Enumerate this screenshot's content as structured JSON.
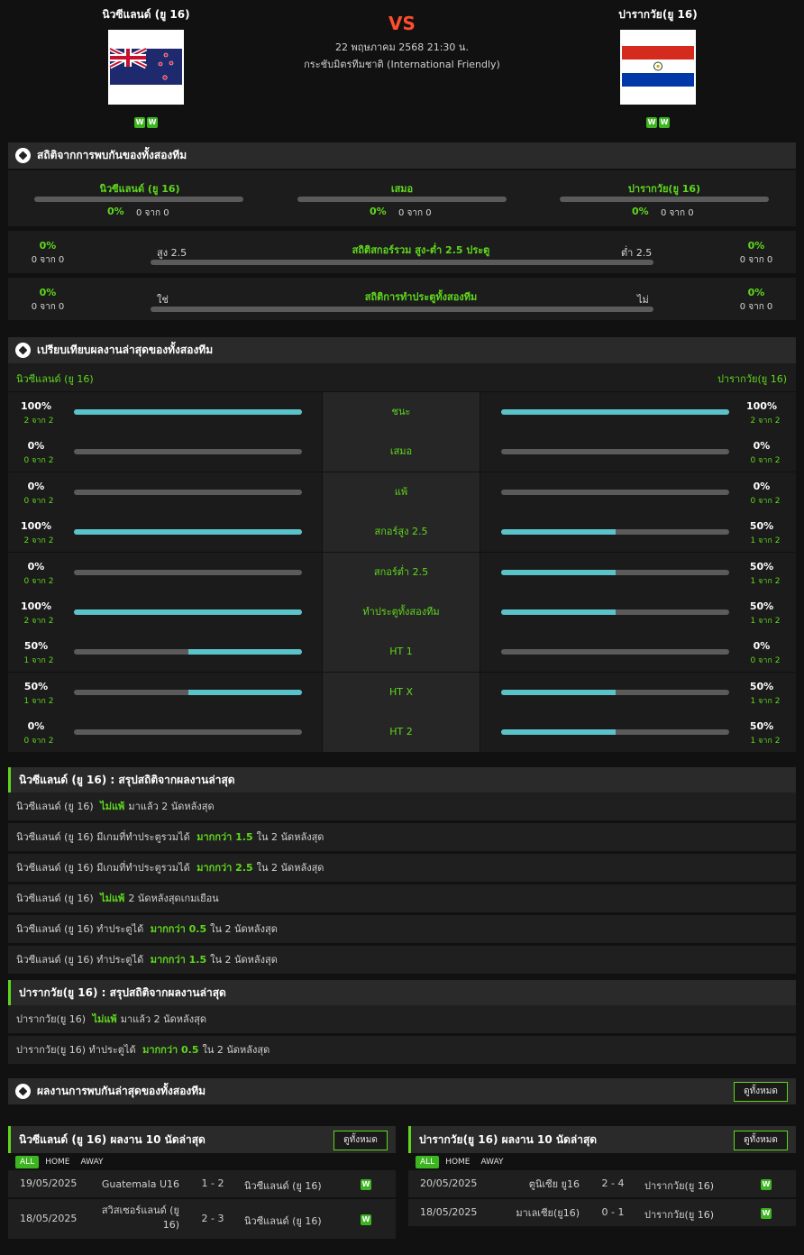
{
  "header": {
    "home_name": "นิวซีแลนด์ (ยู 16)",
    "away_name": "ปารากวัย(ยู 16)",
    "vs": "VS",
    "date": "22 พฤษภาคม 2568 21:30 น.",
    "competition": "กระชับมิตรทีมชาติ (International Friendly)",
    "home_form": [
      "W",
      "W"
    ],
    "away_form": [
      "W",
      "W"
    ]
  },
  "h2h": {
    "title": "สถิติจากการพบกันของทั้งสองทีม",
    "home": {
      "label": "นิวซีแลนด์ (ยู 16)",
      "pct": "0%",
      "of": "0 จาก 0"
    },
    "draw": {
      "label": "เสมอ",
      "pct": "0%",
      "of": "0 จาก 0"
    },
    "away": {
      "label": "ปารากวัย(ยู 16)",
      "pct": "0%",
      "of": "0 จาก 0"
    },
    "ou": {
      "title": "สถิติสกอร์รวม สูง-ต่ำ 2.5 ประตู",
      "left_label": "สูง 2.5",
      "right_label": "ต่ำ 2.5",
      "left_pct": "0%",
      "left_of": "0 จาก 0",
      "right_pct": "0%",
      "right_of": "0 จาก 0"
    },
    "btts": {
      "title": "สถิติการทำประตูทั้งสองทีม",
      "left_label": "ใช่",
      "right_label": "ไม่",
      "left_pct": "0%",
      "left_of": "0 จาก 0",
      "right_pct": "0%",
      "right_of": "0 จาก 0"
    }
  },
  "compare": {
    "title": "เปรียบเทียบผลงานล่าสุดของทั้งสองทีม",
    "home_label": "นิวซีแลนด์ (ยู 16)",
    "away_label": "ปารากวัย(ยู 16)",
    "rows": [
      {
        "label": "ชนะ",
        "home_pct": "100%",
        "home_of": "2 จาก 2",
        "home_val": 1.0,
        "away_pct": "100%",
        "away_of": "2 จาก 2",
        "away_val": 1.0
      },
      {
        "label": "เสมอ",
        "home_pct": "0%",
        "home_of": "0 จาก 2",
        "home_val": 0,
        "away_pct": "0%",
        "away_of": "0 จาก 2",
        "away_val": 0
      },
      {
        "label": "แพ้",
        "home_pct": "0%",
        "home_of": "0 จาก 2",
        "home_val": 0,
        "away_pct": "0%",
        "away_of": "0 จาก 2",
        "away_val": 0
      },
      {
        "label": "สกอร์สูง 2.5",
        "home_pct": "100%",
        "home_of": "2 จาก 2",
        "home_val": 1.0,
        "away_pct": "50%",
        "away_of": "1 จาก 2",
        "away_val": 0.5
      },
      {
        "label": "สกอร์ต่ำ 2.5",
        "home_pct": "0%",
        "home_of": "0 จาก 2",
        "home_val": 0,
        "away_pct": "50%",
        "away_of": "1 จาก 2",
        "away_val": 0.5
      },
      {
        "label": "ทำประตูทั้งสองทีม",
        "home_pct": "100%",
        "home_of": "2 จาก 2",
        "home_val": 1.0,
        "away_pct": "50%",
        "away_of": "1 จาก 2",
        "away_val": 0.5
      },
      {
        "label": "HT 1",
        "home_pct": "50%",
        "home_of": "1 จาก 2",
        "home_val": 0.5,
        "away_pct": "0%",
        "away_of": "0 จาก 2",
        "away_val": 0
      },
      {
        "label": "HT X",
        "home_pct": "50%",
        "home_of": "1 จาก 2",
        "home_val": 0.5,
        "away_pct": "50%",
        "away_of": "1 จาก 2",
        "away_val": 0.5
      },
      {
        "label": "HT 2",
        "home_pct": "0%",
        "home_of": "0 จาก 2",
        "home_val": 0,
        "away_pct": "50%",
        "away_of": "1 จาก 2",
        "away_val": 0.5
      }
    ]
  },
  "home_summary": {
    "title": "นิวซีแลนด์ (ยู 16) : สรุปสถิติจากผลงานล่าสุด",
    "rows": [
      {
        "pre": "นิวซีแลนด์ (ยู 16)",
        "hl": "ไม่แพ้",
        "post": "มาแล้ว 2 นัดหลังสุด"
      },
      {
        "pre": "นิวซีแลนด์ (ยู 16)  มีเกมที่ทำประตูรวมได้",
        "hl": "มากกว่า  1.5",
        "post": "ใน 2 นัดหลังสุด"
      },
      {
        "pre": "นิวซีแลนด์ (ยู 16)  มีเกมที่ทำประตูรวมได้",
        "hl": "มากกว่า  2.5",
        "post": "ใน 2 นัดหลังสุด"
      },
      {
        "pre": "นิวซีแลนด์ (ยู 16)",
        "hl": "ไม่แพ้",
        "post": "2  นัดหลังสุดเกมเยือน"
      },
      {
        "pre": "นิวซีแลนด์ (ยู 16)  ทำประตูได้",
        "hl": "มากกว่า  0.5",
        "post": "ใน 2 นัดหลังสุด"
      },
      {
        "pre": "นิวซีแลนด์ (ยู 16)  ทำประตูได้",
        "hl": "มากกว่า  1.5",
        "post": "ใน 2 นัดหลังสุด"
      }
    ]
  },
  "away_summary": {
    "title": "ปารากวัย(ยู 16) : สรุปสถิติจากผลงานล่าสุด",
    "rows": [
      {
        "pre": "ปารากวัย(ยู 16)",
        "hl": "ไม่แพ้",
        "post": "มาแล้ว 2 นัดหลังสุด"
      },
      {
        "pre": "ปารากวัย(ยู 16)  ทำประตูได้",
        "hl": "มากกว่า  0.5",
        "post": "ใน 2 นัดหลังสุด"
      }
    ]
  },
  "recent_h2h": {
    "title": "ผลงานการพบกันล่าสุดของทั้งสองทีม",
    "view_all": "ดูทั้งหมด"
  },
  "home_last10": {
    "title": "นิวซีแลนด์ (ยู 16) ผลงาน 10 นัดล่าสุด",
    "view_all": "ดูทั้งหมด",
    "tabs": [
      "ALL",
      "HOME",
      "AWAY"
    ],
    "matches": [
      {
        "date": "19/05/2025",
        "home": "Guatemala U16",
        "score": "1 - 2",
        "away": "นิวซีแลนด์ (ยู 16)",
        "result": "W"
      },
      {
        "date": "18/05/2025",
        "home": "สวิสเซอร์แลนด์ (ยู 16)",
        "score": "2 - 3",
        "away": "นิวซีแลนด์ (ยู 16)",
        "result": "W"
      }
    ]
  },
  "away_last10": {
    "title": "ปารากวัย(ยู 16) ผลงาน 10 นัดล่าสุด",
    "view_all": "ดูทั้งหมด",
    "tabs": [
      "ALL",
      "HOME",
      "AWAY"
    ],
    "matches": [
      {
        "date": "20/05/2025",
        "home": "ตูนิเซีย ยู16",
        "score": "2 - 4",
        "away": "ปารากวัย(ยู 16)",
        "result": "W"
      },
      {
        "date": "18/05/2025",
        "home": "มาเลเซีย(ยู16)",
        "score": "0 - 1",
        "away": "ปารากวัย(ยู 16)",
        "result": "W"
      }
    ]
  }
}
